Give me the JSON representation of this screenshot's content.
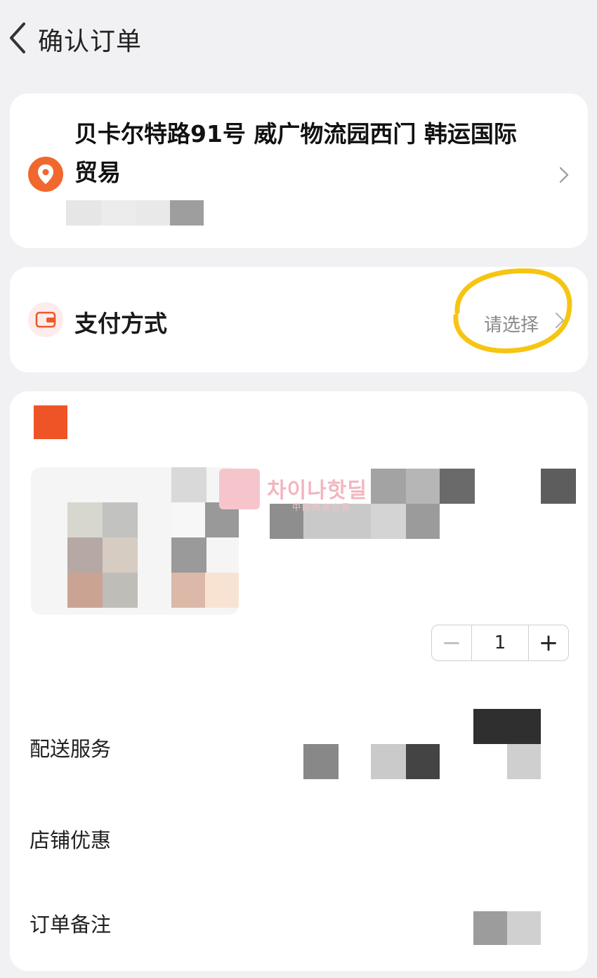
{
  "header": {
    "title": "确认订单",
    "back_icon": "chevron-left-icon"
  },
  "address": {
    "line": "贝卡尔特路91号 威广物流园西门 韩运国际贸易",
    "icon": "location-pin-icon",
    "accent": "#f0682e"
  },
  "payment": {
    "label": "支付方式",
    "value": "请选择",
    "icon": "wallet-icon",
    "highlight_color": "#f6c512"
  },
  "watermark": {
    "title": "차이나핫딜",
    "subtitle": "中国热卖交易"
  },
  "goods": {
    "quantity": "1",
    "minus": "−",
    "plus": "+",
    "shop_badge_color": "#ee5426"
  },
  "rows": {
    "delivery": "配送服务",
    "store_discount": "店铺优惠",
    "order_note": "订单备注"
  }
}
